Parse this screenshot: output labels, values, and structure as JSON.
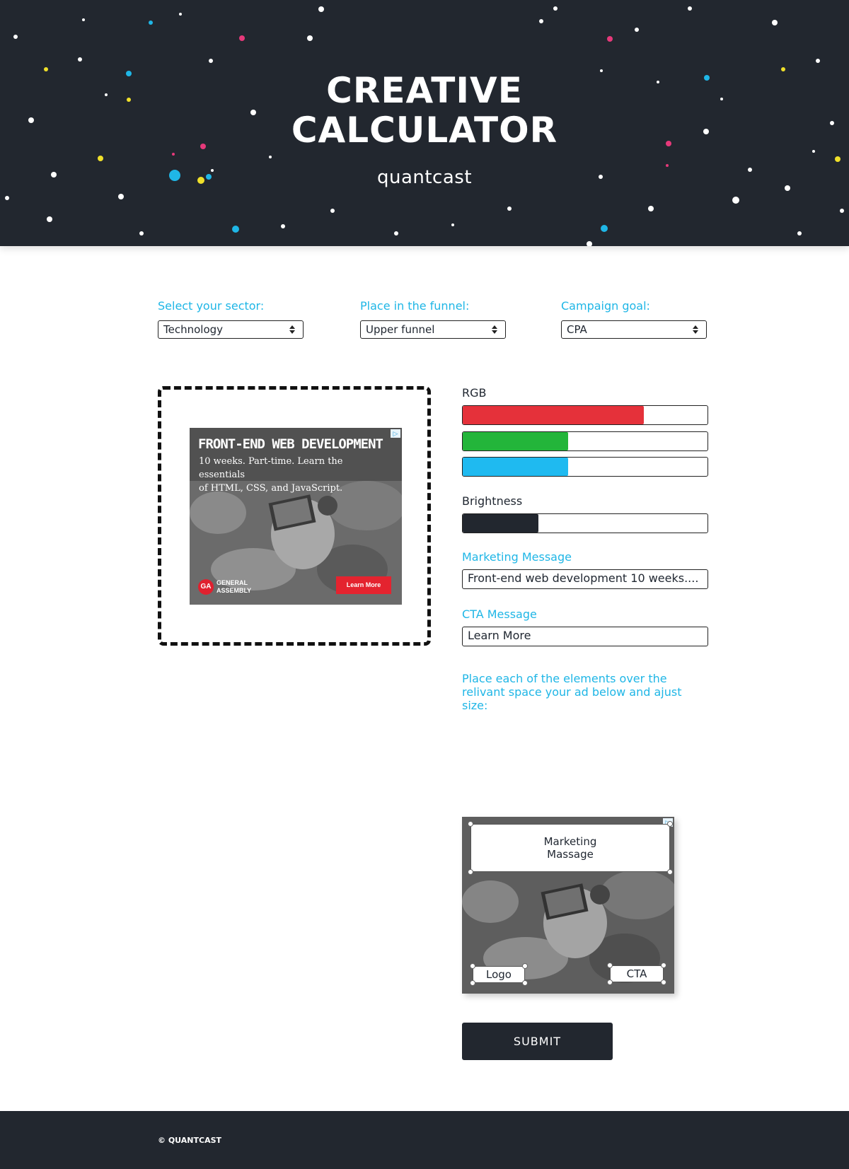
{
  "header": {
    "title_line1": "CREATIVE",
    "title_line2": "CALCULATOR",
    "brand": "quantcast"
  },
  "filters": {
    "sector": {
      "label": "Select your sector:",
      "value": "Technology"
    },
    "funnel": {
      "label": "Place in the funnel:",
      "value": "Upper funnel"
    },
    "goal": {
      "label": "Campaign goal:",
      "value": "CPA"
    }
  },
  "ad_preview": {
    "headline": "FRONT-END WEB DEVELOPMENT",
    "body_line1": "10 weeks. Part-time. Learn the essentials",
    "body_line2": "of HTML, CSS, and JavaScript.",
    "logo_badge": "GA",
    "logo_text_line1": "GENERAL",
    "logo_text_line2": "ASSEMBLY",
    "cta": "Learn More"
  },
  "controls": {
    "rgb_label": "RGB",
    "red_level": 0.74,
    "green_level": 0.43,
    "blue_level": 0.43,
    "brightness_label": "Brightness",
    "brightness_level": 0.31,
    "marketing_label": "Marketing Message",
    "marketing_value": "Front-end web development 10 weeks....",
    "cta_label": "CTA Message",
    "cta_value": "Learn More",
    "colors": {
      "red": "#e5313a",
      "green": "#23b53a",
      "blue": "#1fbaf0",
      "brightness": "#22272f"
    }
  },
  "instructions": "Place each of the elements over the relivant space your ad below and ajust size:",
  "editor": {
    "marketing_box": "Marketing Massage",
    "logo_box": "Logo",
    "cta_box": "CTA"
  },
  "submit_label": "SUBMIT",
  "footer": {
    "copyright": "© QUANTCAST"
  }
}
